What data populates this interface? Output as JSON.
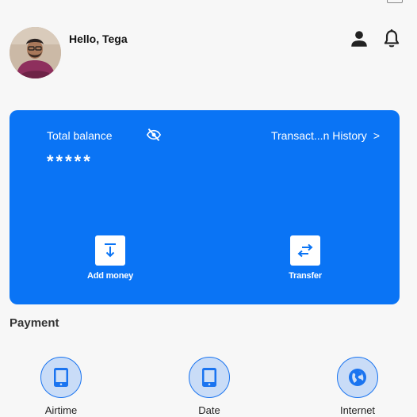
{
  "header": {
    "greeting": "Hello, Tega",
    "avatar_icon": "user-avatar-photo",
    "profile_icon": "person-icon",
    "notification_icon": "bell-icon"
  },
  "balance_card": {
    "label": "Total balance",
    "masked_value": "*****",
    "visibility_icon": "eye-off-icon",
    "history_link": "Transact...n History",
    "history_chevron": ">",
    "background_color": "#0a74f5",
    "actions": [
      {
        "label": "Add money",
        "icon": "arrow-down-to-line-icon"
      },
      {
        "label": "Transfer",
        "icon": "swap-arrows-icon"
      }
    ]
  },
  "payment": {
    "title": "Payment",
    "items": [
      {
        "label": "Airtime",
        "icon": "tablet-icon"
      },
      {
        "label": "Date",
        "icon": "tablet-icon"
      },
      {
        "label": "Internet",
        "icon": "globe-icon"
      }
    ]
  }
}
